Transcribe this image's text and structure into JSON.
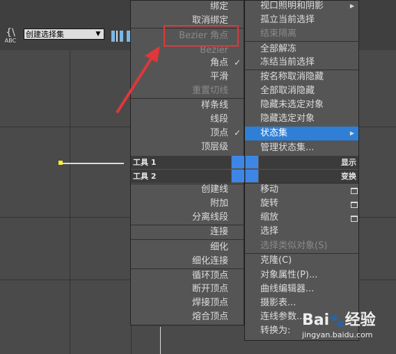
{
  "toolbar": {
    "selection_set_value": "创建选择集",
    "abc_label": "ABC"
  },
  "left_menu": {
    "items": [
      {
        "label": "绑定",
        "dim": false
      },
      {
        "label": "取消绑定",
        "dim": false
      },
      {
        "label": "Bezier 角点",
        "dim": true
      },
      {
        "label": "Bezier",
        "dim": true
      },
      {
        "label": "角点",
        "dim": false
      },
      {
        "label": "平滑",
        "dim": false
      },
      {
        "label": "重置切线",
        "dim": true
      },
      {
        "label": "样条线",
        "dim": false
      },
      {
        "label": "线段",
        "dim": false
      },
      {
        "label": "顶点",
        "dim": false
      },
      {
        "label": "顶层级",
        "dim": false
      },
      {
        "label": "创建线",
        "dim": false
      },
      {
        "label": "附加",
        "dim": false
      },
      {
        "label": "分离线段",
        "dim": false
      },
      {
        "label": "连接",
        "dim": false
      },
      {
        "label": "细化",
        "dim": false
      },
      {
        "label": "细化连接",
        "dim": false
      },
      {
        "label": "循环顶点",
        "dim": false
      },
      {
        "label": "断开顶点",
        "dim": false
      },
      {
        "label": "焊接顶点",
        "dim": false
      },
      {
        "label": "熔合顶点",
        "dim": false
      }
    ]
  },
  "right_menu": {
    "items": [
      {
        "label": "视口照明和阴影"
      },
      {
        "label": "孤立当前选择"
      },
      {
        "label": "结束隔离"
      },
      {
        "label": "全部解冻"
      },
      {
        "label": "冻结当前选择"
      },
      {
        "label": "按名称取消隐藏"
      },
      {
        "label": "全部取消隐藏"
      },
      {
        "label": "隐藏未选定对象"
      },
      {
        "label": "隐藏选定对象"
      },
      {
        "label": "状态集"
      },
      {
        "label": "管理状态集..."
      },
      {
        "label": "移动"
      },
      {
        "label": "旋转"
      },
      {
        "label": "缩放"
      },
      {
        "label": "选择"
      },
      {
        "label": "选择类似对象(S)"
      },
      {
        "label": "克隆(C)"
      },
      {
        "label": "对象属性(P)..."
      },
      {
        "label": "曲线编辑器..."
      },
      {
        "label": "摄影表..."
      },
      {
        "label": "连线参数..."
      },
      {
        "label": "转换为:"
      }
    ]
  },
  "titlebars": {
    "tools1": "工具 1",
    "tools2": "工具 2",
    "display": "显示",
    "transform": "变换"
  },
  "checkmark": "✓",
  "watermark": {
    "brand": "Bai",
    "brand2": "经验",
    "url": "jingyan.baidu.com"
  },
  "colors": {
    "highlight": "#2f7fd6",
    "annotation": "#e0373a",
    "vertex": "#ffee33"
  }
}
